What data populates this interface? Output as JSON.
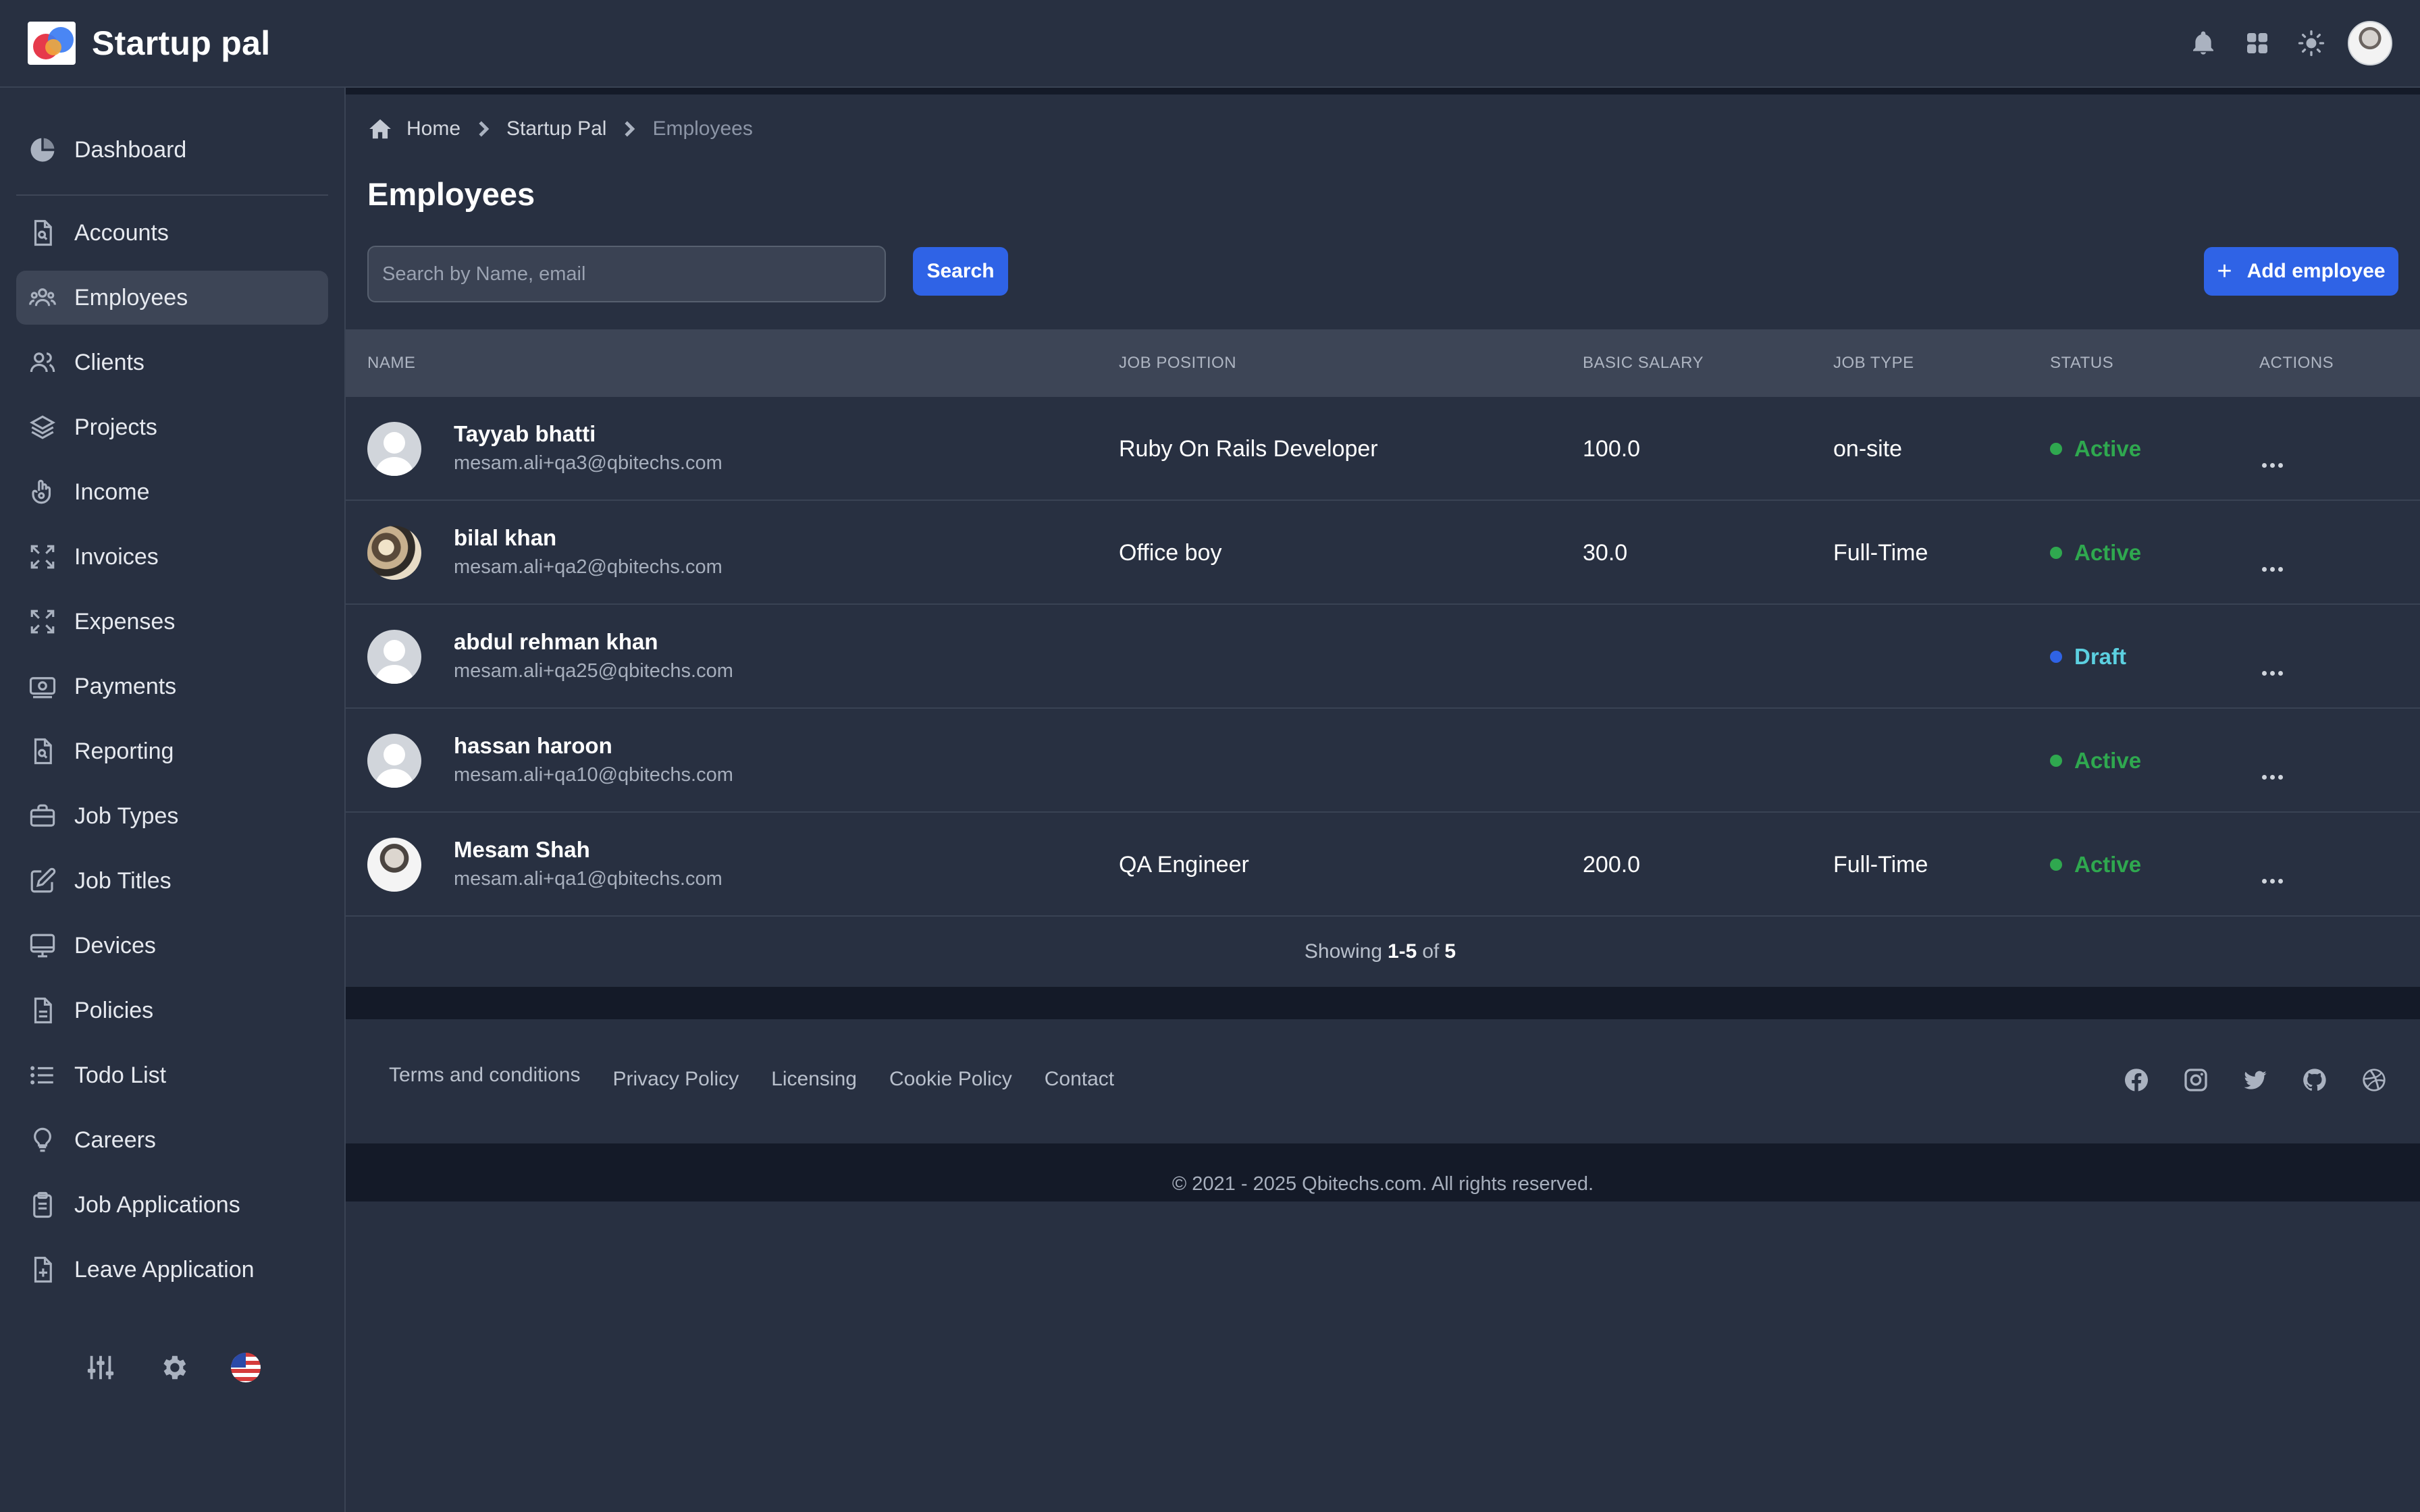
{
  "app": {
    "name": "Startup pal"
  },
  "sidebar": {
    "items": [
      {
        "label": "Dashboard",
        "icon": "pie-chart-icon"
      },
      {
        "label": "Accounts",
        "icon": "document-search-icon"
      },
      {
        "label": "Employees",
        "icon": "users-icon",
        "active": true
      },
      {
        "label": "Clients",
        "icon": "user-group-icon"
      },
      {
        "label": "Projects",
        "icon": "layers-icon"
      },
      {
        "label": "Income",
        "icon": "hand-money-icon"
      },
      {
        "label": "Invoices",
        "icon": "expand-icon"
      },
      {
        "label": "Expenses",
        "icon": "expand-icon"
      },
      {
        "label": "Payments",
        "icon": "cash-icon"
      },
      {
        "label": "Reporting",
        "icon": "document-search-icon"
      },
      {
        "label": "Job Types",
        "icon": "briefcase-icon"
      },
      {
        "label": "Job Titles",
        "icon": "pencil-square-icon"
      },
      {
        "label": "Devices",
        "icon": "monitor-icon"
      },
      {
        "label": "Policies",
        "icon": "document-icon"
      },
      {
        "label": "Todo List",
        "icon": "list-icon"
      },
      {
        "label": "Careers",
        "icon": "lightbulb-icon"
      },
      {
        "label": "Job Applications",
        "icon": "clipboard-icon"
      },
      {
        "label": "Leave Application",
        "icon": "document-plus-icon"
      }
    ]
  },
  "breadcrumb": {
    "home": "Home",
    "section": "Startup Pal",
    "current": "Employees"
  },
  "page": {
    "title": "Employees",
    "search_placeholder": "Search by Name, email",
    "search_value": "",
    "search_button": "Search",
    "add_button": "Add employee"
  },
  "table": {
    "headers": {
      "name": "NAME",
      "job_position": "JOB POSITION",
      "basic_salary": "BASIC SALARY",
      "job_type": "JOB TYPE",
      "status": "STATUS",
      "actions": "ACTIONS"
    },
    "rows": [
      {
        "name": "Tayyab bhatti",
        "email": "mesam.ali+qa3@qbitechs.com",
        "job_position": "Ruby On Rails Developer",
        "basic_salary": "100.0",
        "job_type": "on-site",
        "status": "Active",
        "avatar": "default"
      },
      {
        "name": "bilal khan",
        "email": "mesam.ali+qa2@qbitechs.com",
        "job_position": "Office boy",
        "basic_salary": "30.0",
        "job_type": "Full-Time",
        "status": "Active",
        "avatar": "photo"
      },
      {
        "name": "abdul rehman khan",
        "email": "mesam.ali+qa25@qbitechs.com",
        "job_position": "",
        "basic_salary": "",
        "job_type": "",
        "status": "Draft",
        "avatar": "default"
      },
      {
        "name": "hassan haroon",
        "email": "mesam.ali+qa10@qbitechs.com",
        "job_position": "",
        "basic_salary": "",
        "job_type": "",
        "status": "Active",
        "avatar": "default"
      },
      {
        "name": "Mesam Shah",
        "email": "mesam.ali+qa1@qbitechs.com",
        "job_position": "QA Engineer",
        "basic_salary": "200.0",
        "job_type": "Full-Time",
        "status": "Active",
        "avatar": "photo"
      }
    ],
    "showing": {
      "prefix": "Showing",
      "range": "1-5",
      "of": "of",
      "total": "5"
    }
  },
  "footer": {
    "links": [
      "Terms and conditions",
      "Privacy Policy",
      "Licensing",
      "Cookie Policy",
      "Contact"
    ],
    "socials": [
      "facebook-icon",
      "instagram-icon",
      "twitter-icon",
      "github-icon",
      "dribbble-icon"
    ],
    "copyright": "© 2021 - 2025 Qbitechs.com. All rights reserved."
  },
  "colors": {
    "background": "#283041",
    "accent": "#2f63e6",
    "active_status": "#2fa84f",
    "draft_status": "#5cd0e0",
    "draft_dot": "#2f63e6"
  }
}
